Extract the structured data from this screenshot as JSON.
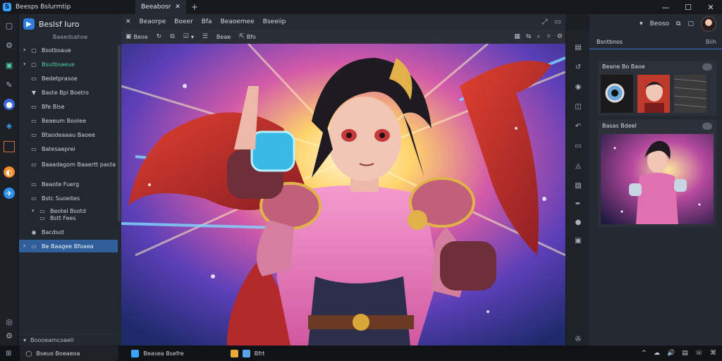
{
  "window": {
    "app_title": "Beesps Bslurmtip",
    "tab_label": "Beeabosr",
    "tab_close": "✕",
    "tab_add": "+",
    "controls": [
      "—",
      "☐",
      "✕"
    ]
  },
  "explorer": {
    "title": "Beslsf Iuro",
    "subtitle": "Baaedsahoe",
    "items": [
      {
        "label": "Bsotbsaue",
        "icon": "folder-icon",
        "chev": "▾"
      },
      {
        "label": "Bsutbsaeue",
        "icon": "folder-icon",
        "chev": "▾",
        "state": "active"
      },
      {
        "label": "Bedetprasoe",
        "icon": "file-icon",
        "chev": ""
      },
      {
        "label": "Baste Bpi Boetro",
        "icon": "shape-icon",
        "chev": ""
      },
      {
        "label": "Bfe Blse",
        "icon": "file-icon",
        "chev": ""
      },
      {
        "label": "Beaeum Boolee",
        "icon": "file-icon",
        "chev": ""
      },
      {
        "label": "Btaodeaaau Baoee",
        "icon": "file-icon",
        "chev": ""
      },
      {
        "label": "Batesaeprei",
        "icon": "file-icon",
        "chev": ""
      },
      {
        "label": "Baaadagom Baaertt pasta",
        "icon": "file-icon",
        "chev": ""
      },
      {
        "label": "Beaote Fuerg",
        "icon": "file-icon",
        "chev": ""
      },
      {
        "label": "Bstc Suoeites",
        "icon": "file-icon",
        "chev": ""
      },
      {
        "label": "Beotel Bsotd",
        "icon": "file-icon",
        "chev": "▾"
      },
      {
        "label": "Bstt Fees",
        "icon": "file-icon",
        "chev": ""
      },
      {
        "label": "Bacdsot",
        "icon": "record-icon",
        "chev": ""
      },
      {
        "label": "Be Baagee Bfoaea",
        "icon": "file-icon",
        "chev": "▾",
        "state": "selected"
      }
    ],
    "footer": "Boooeamcoaell"
  },
  "menu": {
    "items": [
      "Beaorpe",
      "Boeer",
      "Bfa",
      "Beaoemee",
      "Bseeiip"
    ]
  },
  "toolbar": {
    "items": [
      {
        "icon": "save-icon",
        "label": "Beoe"
      },
      {
        "icon": "rotate-icon",
        "label": ""
      },
      {
        "icon": "clone-icon",
        "label": ""
      },
      {
        "icon": "check-icon",
        "label": "▾"
      },
      {
        "icon": "list-icon",
        "label": ""
      },
      {
        "icon": "",
        "label": "Beae"
      },
      {
        "icon": "share-icon",
        "label": "Bfo"
      }
    ]
  },
  "right_panel": {
    "user_label": "Beoso",
    "tabs": [
      "Bsntbnos"
    ],
    "tab_right": "Biih",
    "section1_title": "Beane Bo Baoe",
    "section2_title": "Basas Bdeel"
  },
  "taskbar": {
    "search_placeholder": "Bseuo Boeaeoa",
    "apps": [
      {
        "label": "Beasea Bsefre"
      },
      {
        "label": "Bfrt"
      }
    ],
    "tray": [
      "^",
      "☁",
      "🔊",
      "▤",
      "☏",
      "⌘"
    ]
  },
  "colors": {
    "accent": "#2e7fe0",
    "selected_row": "#2f5e9a",
    "active_text": "#4fd1a5"
  }
}
